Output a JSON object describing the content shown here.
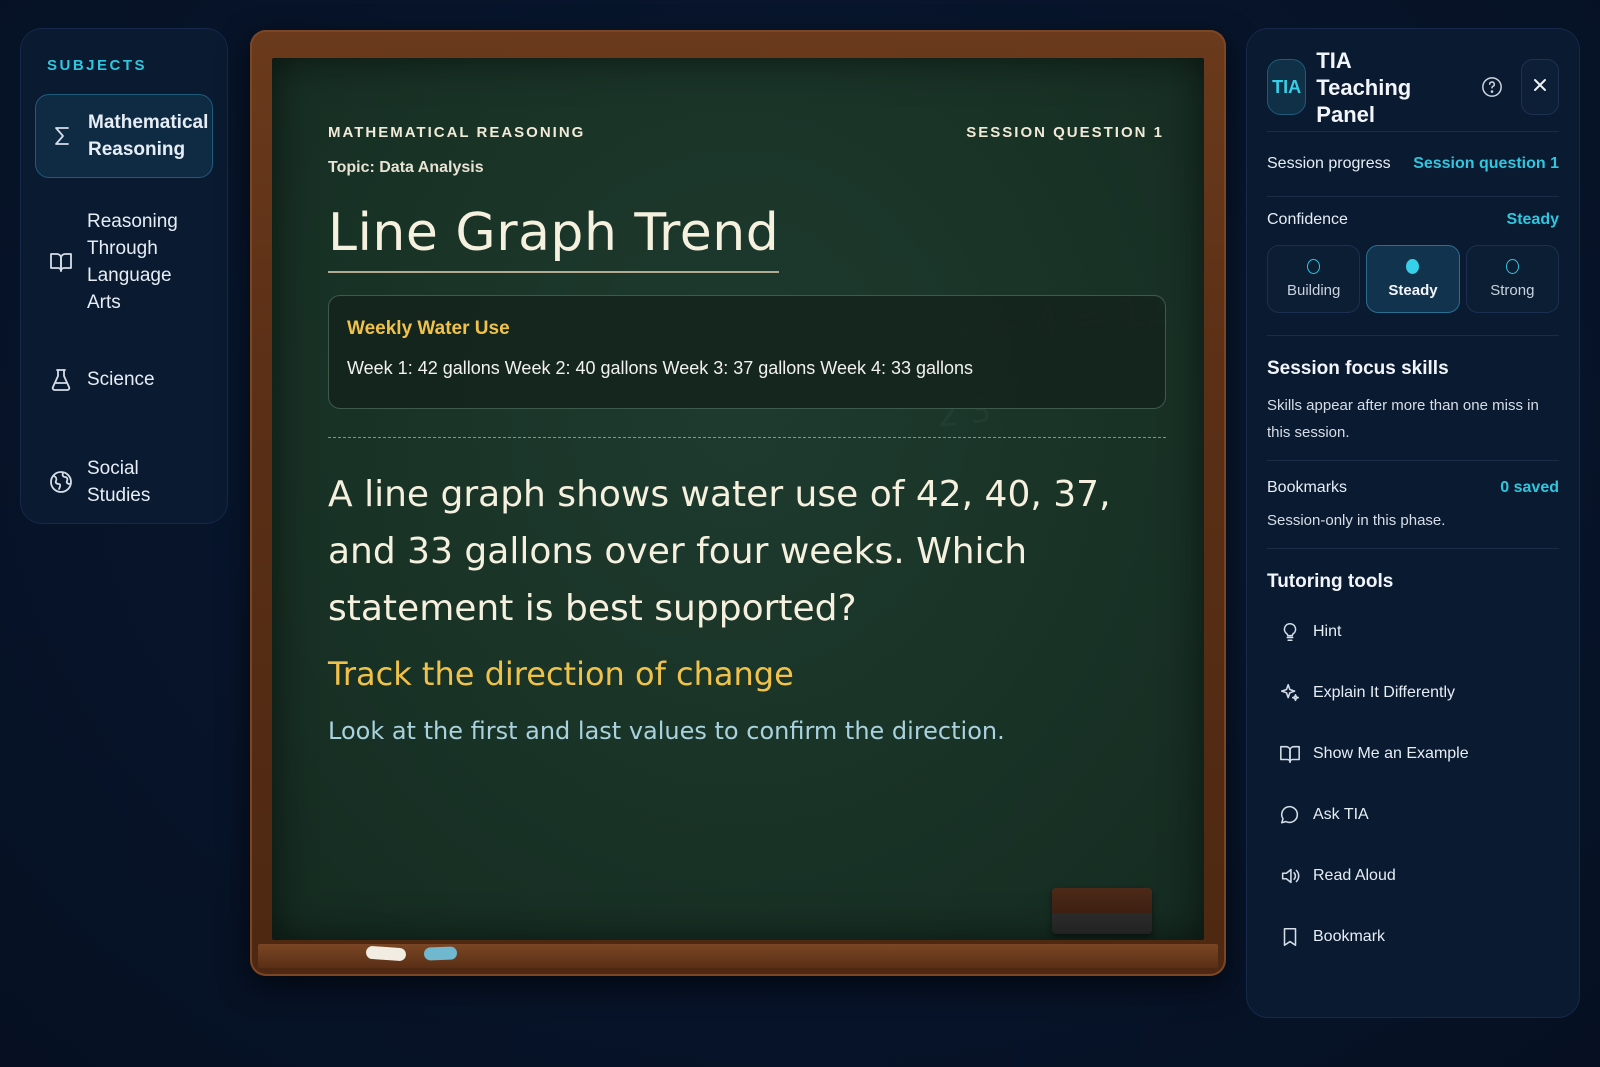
{
  "sidebar": {
    "heading": "SUBJECTS",
    "items": [
      {
        "label": "Mathematical Reasoning",
        "icon": "sigma-icon",
        "active": true
      },
      {
        "label": "Reasoning Through Language Arts",
        "icon": "book-icon",
        "active": false
      },
      {
        "label": "Science",
        "icon": "flask-icon",
        "active": false
      },
      {
        "label": "Social Studies",
        "icon": "globe-icon",
        "active": false
      }
    ]
  },
  "board": {
    "subject_label": "MATHEMATICAL REASONING",
    "session_label": "SESSION QUESTION 1",
    "topic": "Topic: Data Analysis",
    "title": "Line Graph Trend",
    "data_card": {
      "title": "Weekly Water Use",
      "text": "Week 1: 42 gallons Week 2: 40 gallons Week 3: 37 gallons Week 4: 33 gallons"
    },
    "question": "A line graph shows water use of 42, 40, 37, and 33 gallons over four weeks. Which statement is best supported?",
    "hint_title": "Track the direction of change",
    "hint_text": "Look at the first and last values to confirm the direction.",
    "chalk_colors": [
      "#f2ede2",
      "#6fb8cf"
    ]
  },
  "panel": {
    "badge": "TIA",
    "title": "TIA Teaching Panel",
    "progress_label": "Session progress",
    "progress_value": "Session question 1",
    "confidence_label": "Confidence",
    "confidence_value": "Steady",
    "confidence_options": [
      {
        "label": "Building",
        "selected": false
      },
      {
        "label": "Steady",
        "selected": true
      },
      {
        "label": "Strong",
        "selected": false
      }
    ],
    "focus_title": "Session focus skills",
    "focus_text": "Skills appear after more than one miss in this session.",
    "bookmarks_label": "Bookmarks",
    "bookmarks_value": "0 saved",
    "bookmarks_text": "Session-only in this phase.",
    "tools_title": "Tutoring tools",
    "tools": [
      {
        "label": "Hint",
        "icon": "lightbulb-icon"
      },
      {
        "label": "Explain It Differently",
        "icon": "sparkle-icon"
      },
      {
        "label": "Show Me an Example",
        "icon": "book-icon"
      },
      {
        "label": "Ask TIA",
        "icon": "chat-bubble-icon"
      },
      {
        "label": "Read Aloud",
        "icon": "speaker-icon"
      },
      {
        "label": "Bookmark",
        "icon": "bookmark-icon"
      }
    ]
  },
  "colors": {
    "accent": "#2fc7e0",
    "chalk_yellow": "#f1c24a",
    "chalk_blue": "#a8d2dd",
    "board_green": "#193226",
    "frame_wood": "#5a2f16"
  }
}
